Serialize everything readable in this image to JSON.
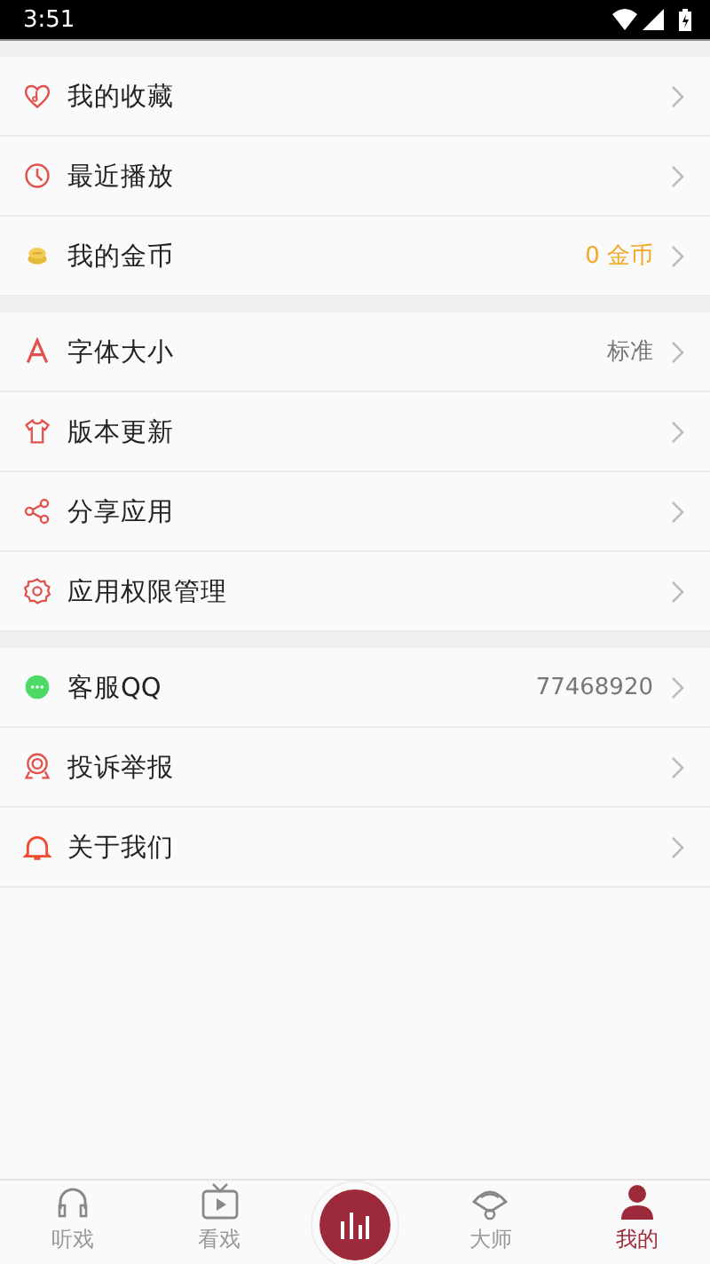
{
  "status_bar": {
    "time": "3:51"
  },
  "sections": [
    {
      "items": [
        {
          "kind": "favorite",
          "label": "我的收藏"
        },
        {
          "kind": "history",
          "label": "最近播放"
        },
        {
          "kind": "coin",
          "label": "我的金币",
          "value": "0 金币",
          "highlighted": true
        }
      ]
    },
    {
      "items": [
        {
          "kind": "font",
          "label": "字体大小",
          "value": "标准",
          "highlighted": false
        },
        {
          "kind": "shirt",
          "label": "版本更新"
        },
        {
          "kind": "share",
          "label": "分享应用"
        },
        {
          "kind": "gear",
          "label": "应用权限管理"
        }
      ]
    },
    {
      "items": [
        {
          "kind": "chat",
          "label": "客服QQ",
          "value": "77468920",
          "highlighted": false
        },
        {
          "kind": "medal",
          "label": "投诉举报"
        },
        {
          "kind": "bell",
          "label": "关于我们"
        }
      ]
    }
  ],
  "tabs": [
    {
      "kind": "headphones",
      "label": "听戏",
      "selected": false
    },
    {
      "kind": "tv",
      "label": "看戏",
      "selected": false
    },
    {
      "kind": "center"
    },
    {
      "kind": "fan",
      "label": "大师",
      "selected": false
    },
    {
      "kind": "person",
      "label": "我的",
      "selected": true
    }
  ]
}
